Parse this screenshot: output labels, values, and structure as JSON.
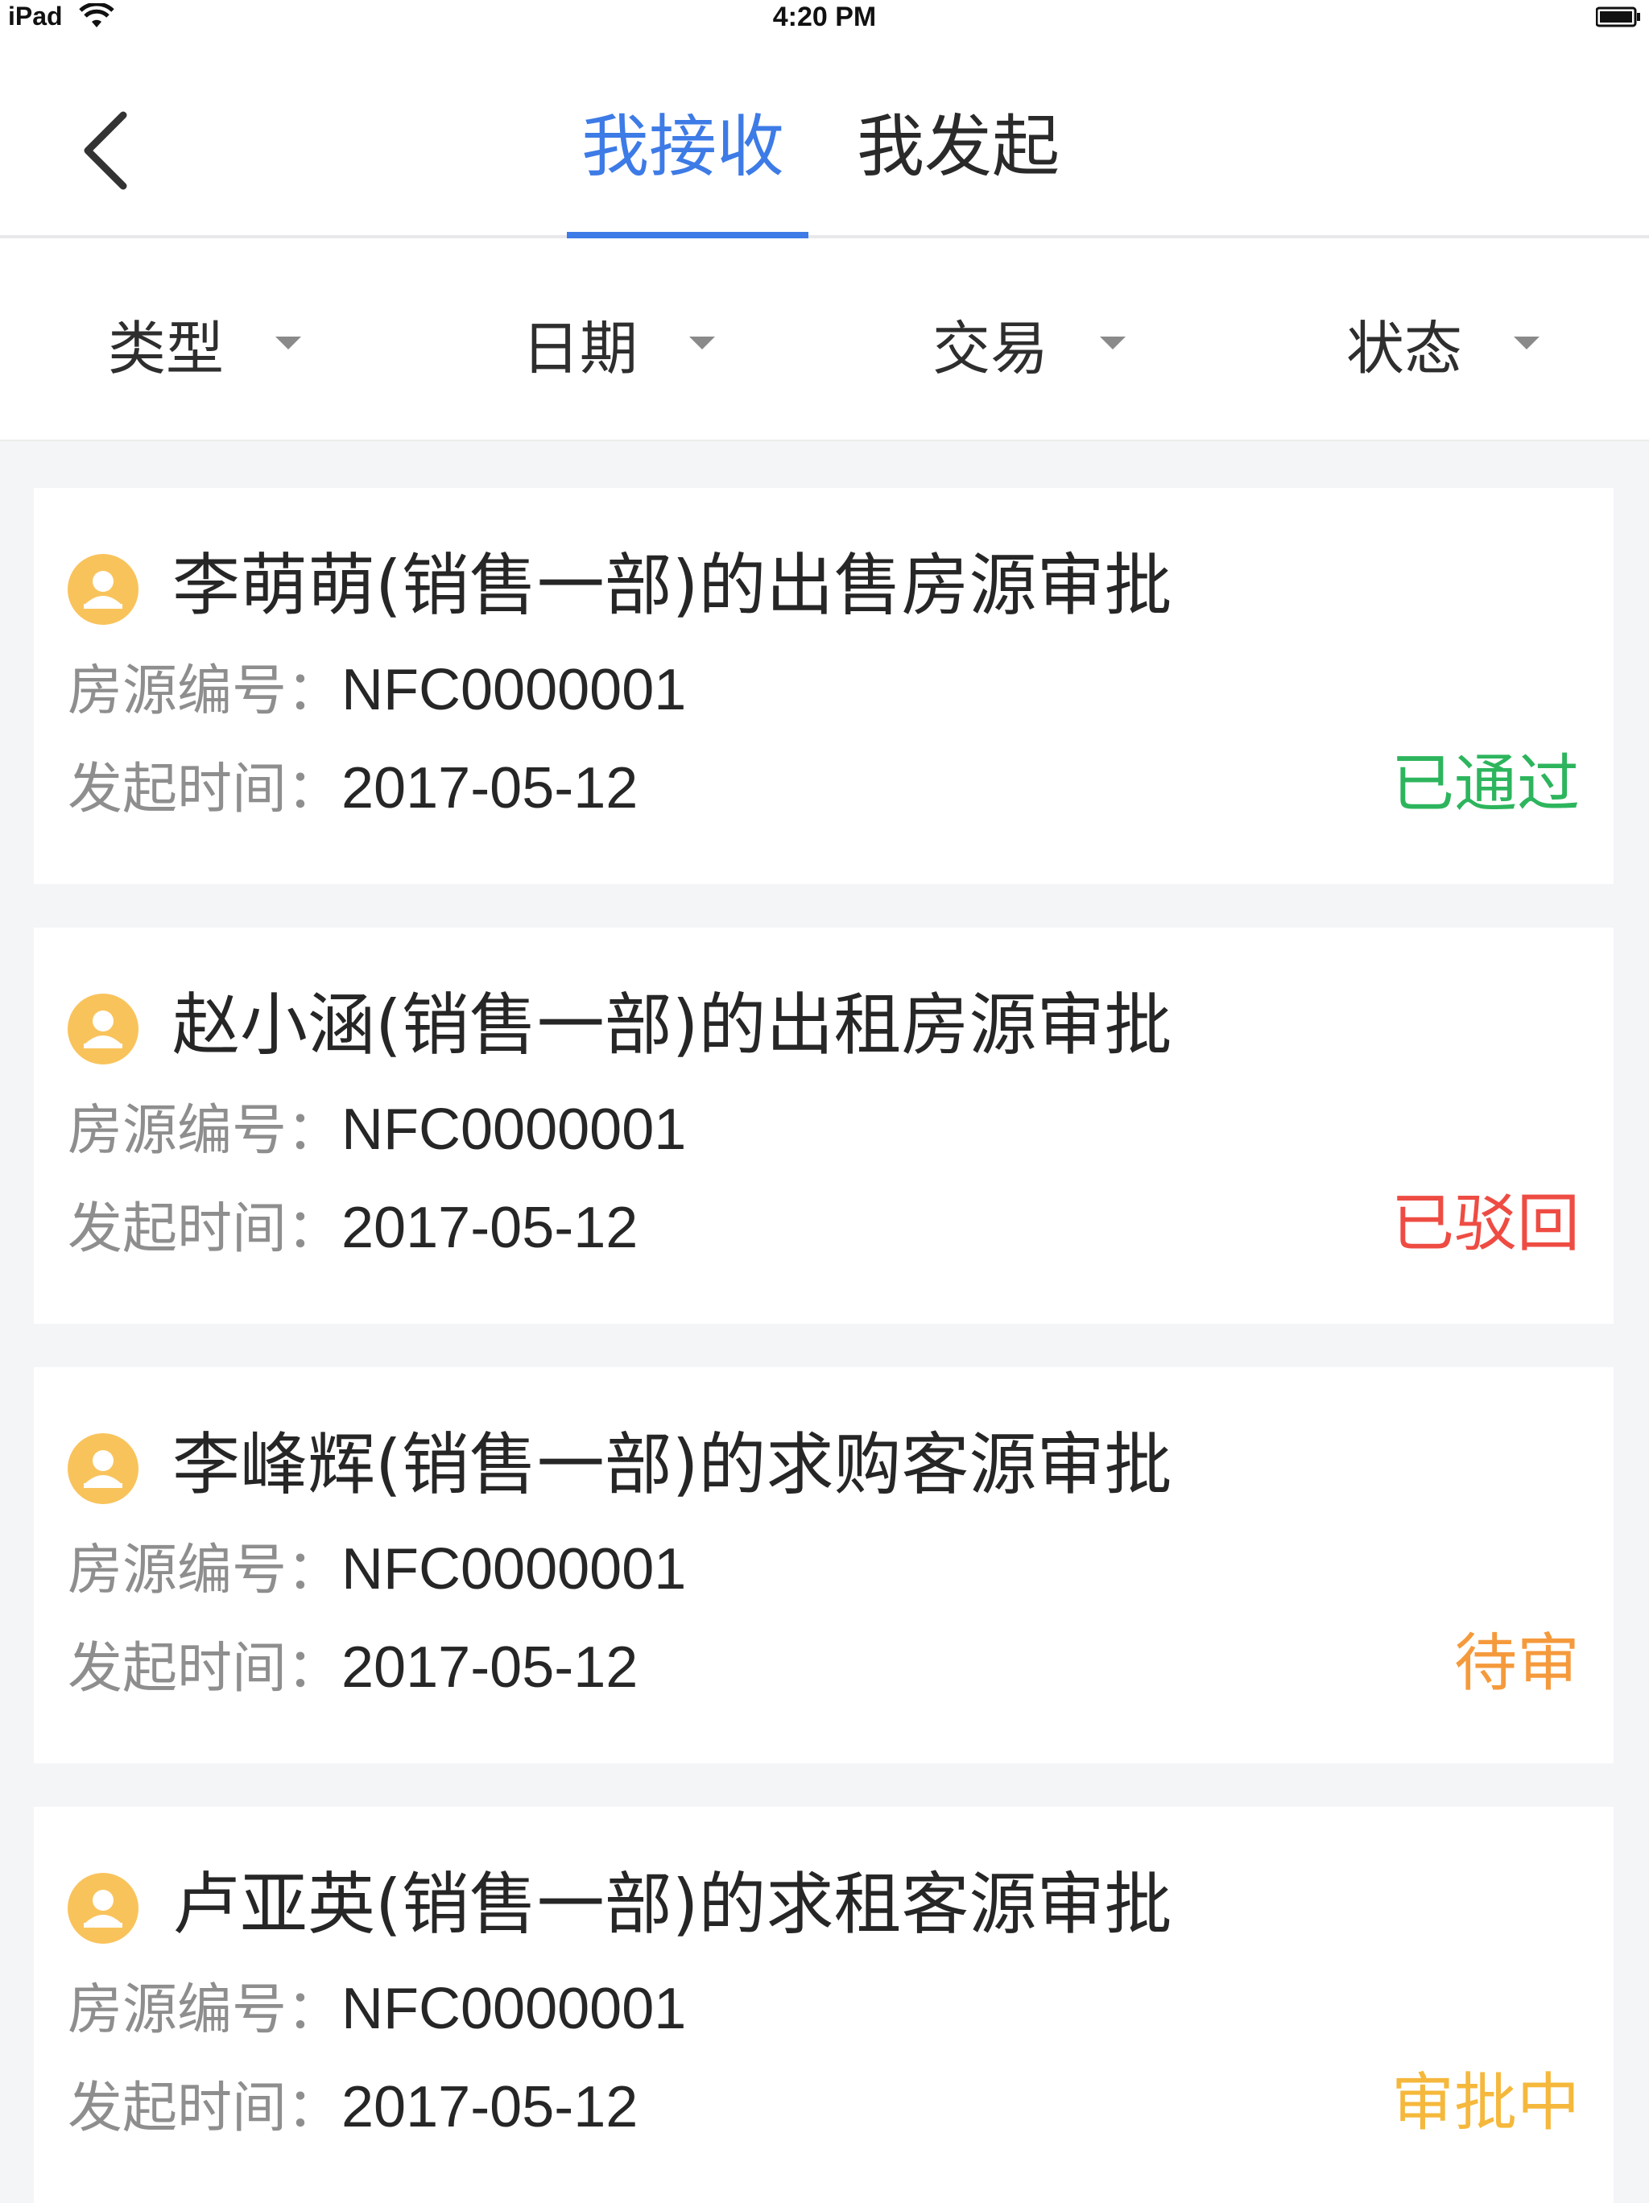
{
  "status_bar": {
    "device": "iPad",
    "time": "4:20 PM"
  },
  "nav": {
    "back_icon": "chevron-left-icon",
    "tabs": [
      {
        "label": "我接收",
        "active": true
      },
      {
        "label": "我发起",
        "active": false
      }
    ],
    "active_color": "#3d7be6"
  },
  "filters": [
    {
      "label": "类型"
    },
    {
      "label": "日期"
    },
    {
      "label": "交易"
    },
    {
      "label": "状态"
    }
  ],
  "cards": [
    {
      "title": "李萌萌(销售一部)的出售房源审批",
      "code_label": "房源编号：",
      "code_value": "NFC0000001",
      "date_label": "发起时间：",
      "date_value": "2017-05-12",
      "status": "已通过",
      "status_color": "#2db55d"
    },
    {
      "title": "赵小涵(销售一部)的出租房源审批",
      "code_label": "房源编号：",
      "code_value": "NFC0000001",
      "date_label": "发起时间：",
      "date_value": "2017-05-12",
      "status": "已驳回",
      "status_color": "#ee4c43"
    },
    {
      "title": "李峰辉(销售一部)的求购客源审批",
      "code_label": "房源编号：",
      "code_value": "NFC0000001",
      "date_label": "发起时间：",
      "date_value": "2017-05-12",
      "status": "待审",
      "status_color": "#f59a3c"
    },
    {
      "title": "卢亚英(销售一部)的求租客源审批",
      "code_label": "房源编号：",
      "code_value": "NFC0000001",
      "date_label": "发起时间：",
      "date_value": "2017-05-12",
      "status": "审批中",
      "status_color": "#f5b83c"
    }
  ],
  "avatar_color": "#f9c35c"
}
